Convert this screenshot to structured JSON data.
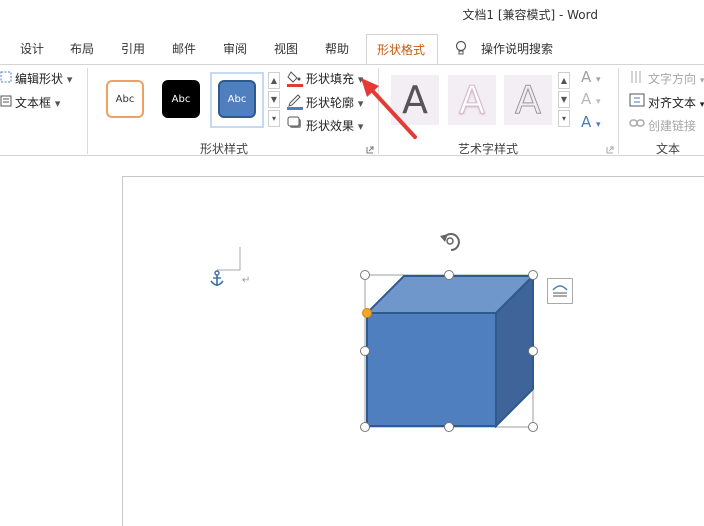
{
  "window": {
    "title": "文档1 [兼容模式] - Word"
  },
  "tabs": [
    {
      "label": "设计"
    },
    {
      "label": "布局"
    },
    {
      "label": "引用"
    },
    {
      "label": "邮件"
    },
    {
      "label": "审阅"
    },
    {
      "label": "视图"
    },
    {
      "label": "帮助"
    },
    {
      "label": "形状格式",
      "active": true
    }
  ],
  "tell_me": {
    "label": "操作说明搜索"
  },
  "insert_shapes": {
    "edit_shape": "编辑形状",
    "text_box": "文本框"
  },
  "shape_styles": {
    "group_label": "形状样式",
    "presets": [
      {
        "label": "Abc",
        "style": "orange-outline"
      },
      {
        "label": "Abc",
        "style": "black-fill"
      },
      {
        "label": "Abc",
        "style": "blue-fill",
        "selected": true
      }
    ],
    "fill": "形状填充",
    "outline": "形状轮廓",
    "effects": "形状效果"
  },
  "wordart_styles": {
    "group_label": "艺术字样式",
    "presets": [
      {
        "glyph": "A"
      },
      {
        "glyph": "A"
      },
      {
        "glyph": "A"
      }
    ],
    "glyph_small": "A"
  },
  "text_group": {
    "group_label": "文本",
    "direction": "文字方向",
    "align": "对齐文本",
    "link": "创建链接"
  },
  "document": {
    "shape": "cube",
    "shape_fill": "#4f7fbf",
    "shape_outline": "#2f5a8f"
  },
  "colors": {
    "accent_tab": "#c55a11",
    "arrow": "#e53935",
    "selection_handle_fill": "#ffffff",
    "adjust_handle": "#f5a623"
  }
}
